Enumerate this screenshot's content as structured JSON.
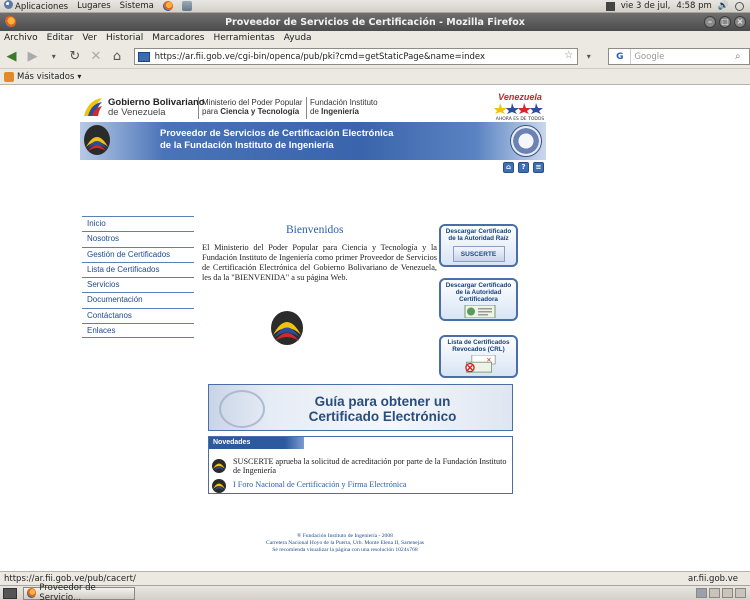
{
  "top_panel": {
    "menus": [
      "Aplicaciones",
      "Lugares",
      "Sistema"
    ],
    "date": "vie  3 de jul,",
    "time": "4:58 pm"
  },
  "window": {
    "title": "Proveedor de Servicios de Certificación - Mozilla Firefox"
  },
  "menubar": [
    "Archivo",
    "Editar",
    "Ver",
    "Historial",
    "Marcadores",
    "Herramientas",
    "Ayuda"
  ],
  "navbar": {
    "url": "https://ar.fii.gob.ve/cgi-bin/openca/pub/pki?cmd=getStaticPage&name=index",
    "search_placeholder": "Google",
    "icons": [
      "back-icon",
      "forward-icon",
      "dropdown-icon",
      "reload-icon",
      "stop-icon",
      "home-icon"
    ]
  },
  "bookmarks": {
    "most_visited": "Más visitados"
  },
  "page": {
    "gob_line1": "Gobierno Bolivariano",
    "gob_line2": "de Venezuela",
    "min_line1": "Ministerio del Poder Popular",
    "min_line2a": "para ",
    "min_line2b": "Ciencia y Tecnología",
    "fii_line1": "Fundación Instituto",
    "fii_line2a": "de ",
    "fii_line2b": "Ingeniería",
    "venezuela_logo": "Venezuela",
    "venezuela_slogan": "AHORA ES DE TODOS",
    "banner_line1": "Proveedor de Servicios de Certificación Electrónica",
    "banner_line2": "de la Fundación Instituto de Ingeniería",
    "nav": [
      "Inicio",
      "Nosotros",
      "Gestión de Certificados",
      "Lista de Certificados",
      "Servicios",
      "Documentación",
      "Contáctanos",
      "Enlaces"
    ],
    "welcome": "Bienvenidos",
    "intro": "El Ministerio del Poder Popular para Ciencia y Tecnología y la Fundación Instituto de Ingeniería como primer Proveedor de Servicios de Certificación Electrónica del Gobierno Bolivariano de Venezuela, les da la \"BIENVENIDA\" a su página Web.",
    "right_buttons": [
      {
        "line1": "Descargar Certificado",
        "line2": "de la Autoridad Raíz",
        "line3": "",
        "image_label": "SUSCERTE"
      },
      {
        "line1": "Descargar Certificado",
        "line2": "de la Autoridad",
        "line3": "Certificadora",
        "image_label": ""
      },
      {
        "line1": "Lista de Certificados",
        "line2": "Revocados (CRL)",
        "line3": "",
        "image_label": ""
      }
    ],
    "guide_line1": "Guía para obtener un",
    "guide_line2": "Certificado Electrónico",
    "novedades_title": "Novedades",
    "novedades": [
      "SUSCERTE aprueba la solicitud de acreditación por parte de la Fundación Instituto de Ingeniería",
      "I Foro Nacional de Certificación y Firma Electrónica"
    ],
    "footer_line1": "® Fundación Instituto de Ingeniería - 2008",
    "footer_line2": "Carretera Nacional Hoyo de la Puerta, Urb. Monte Elena II, Sartenejas",
    "footer_line3": "Se recomienda visualizar la página con una resolución 1024x768"
  },
  "status": {
    "left": "https://ar.fii.gob.ve/pub/cacert/",
    "right": "ar.fii.gob.ve"
  },
  "taskbar": {
    "window_button": "Proveedor de Servicio..."
  },
  "colors": {
    "accent_blue": "#2d5fa8",
    "banner_blue": "#3a64ab",
    "nav_line": "#5b7fb8"
  }
}
